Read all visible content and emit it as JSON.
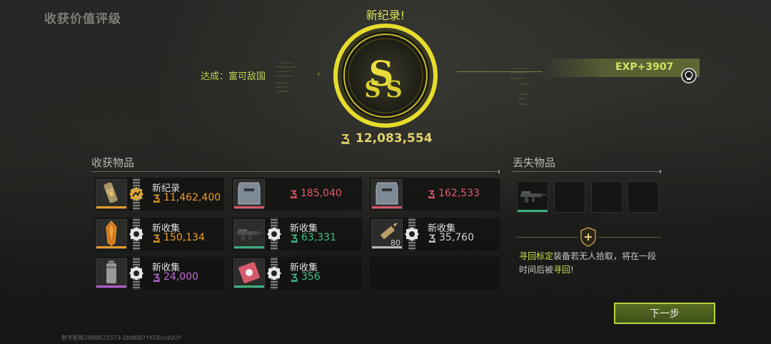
{
  "page_title": "收获价值评级",
  "new_record_label": "新纪录!",
  "medal": {
    "rank": "SSS",
    "icon": "sss-rank-medal-icon"
  },
  "achievement": "达成：富可敌国",
  "exp": "EXP+3907",
  "total_value": "12,083,554",
  "harvest": {
    "title": "收获物品",
    "items": [
      {
        "tag": "新纪录",
        "value": "11,462,400",
        "value_color": "#ef9b2a",
        "rarity_color": "#e49a2b",
        "badge": "record-badge-icon",
        "thumb": "grenade-canister-icon"
      },
      {
        "tag": "",
        "value": "185,040",
        "value_color": "#e35a6a",
        "rarity_color": "#d6566a",
        "badge": "",
        "thumb": "armor-plate-icon"
      },
      {
        "tag": "",
        "value": "162,533",
        "value_color": "#e35a6a",
        "rarity_color": "#d6566a",
        "badge": "",
        "thumb": "armor-plate-icon"
      },
      {
        "tag": "新收集",
        "value": "150,134",
        "value_color": "#ef9b2a",
        "rarity_color": "#e49a2b",
        "badge": "new-collect-badge-icon",
        "thumb": "amber-crystal-icon"
      },
      {
        "tag": "新收集",
        "value": "63,331",
        "value_color": "#3fc08a",
        "rarity_color": "#3bb07e",
        "badge": "new-collect-badge-icon",
        "thumb": "rifle-icon"
      },
      {
        "tag": "新收集",
        "value": "35,760",
        "value_color": "#cfcfcf",
        "rarity_color": "#b8b8b8",
        "badge": "new-collect-badge-icon",
        "thumb": "bullet-icon",
        "count": "80"
      },
      {
        "tag": "新收集",
        "value": "24,000",
        "value_color": "#c46ad6",
        "rarity_color": "#b25ad0",
        "badge": "new-collect-badge-icon",
        "thumb": "smoke-grenade-icon"
      },
      {
        "tag": "新收集",
        "value": "356",
        "value_color": "#3fc08a",
        "rarity_color": "#3bb07e",
        "badge": "new-collect-badge-icon",
        "thumb": "card-icon"
      },
      {
        "tag": "",
        "value": "",
        "value_color": "",
        "rarity_color": "",
        "badge": "",
        "thumb": ""
      }
    ]
  },
  "lost": {
    "title": "丢失物品",
    "slots": [
      {
        "thumb": "rifle-icon",
        "rarity_color": "#3bb07e"
      },
      {
        "thumb": "",
        "rarity_color": ""
      },
      {
        "thumb": "",
        "rarity_color": ""
      },
      {
        "thumb": "",
        "rarity_color": ""
      }
    ],
    "retrieve_keyword": "寻回标定",
    "retrieve_middle": "装备若无人拾取，将在一段时间后被",
    "retrieve_word": "寻回",
    "retrieve_end": "!"
  },
  "next_button": "下一步",
  "footer_id": "数字昵称2888622573-ZbNBB7YKUEcrdVOY"
}
